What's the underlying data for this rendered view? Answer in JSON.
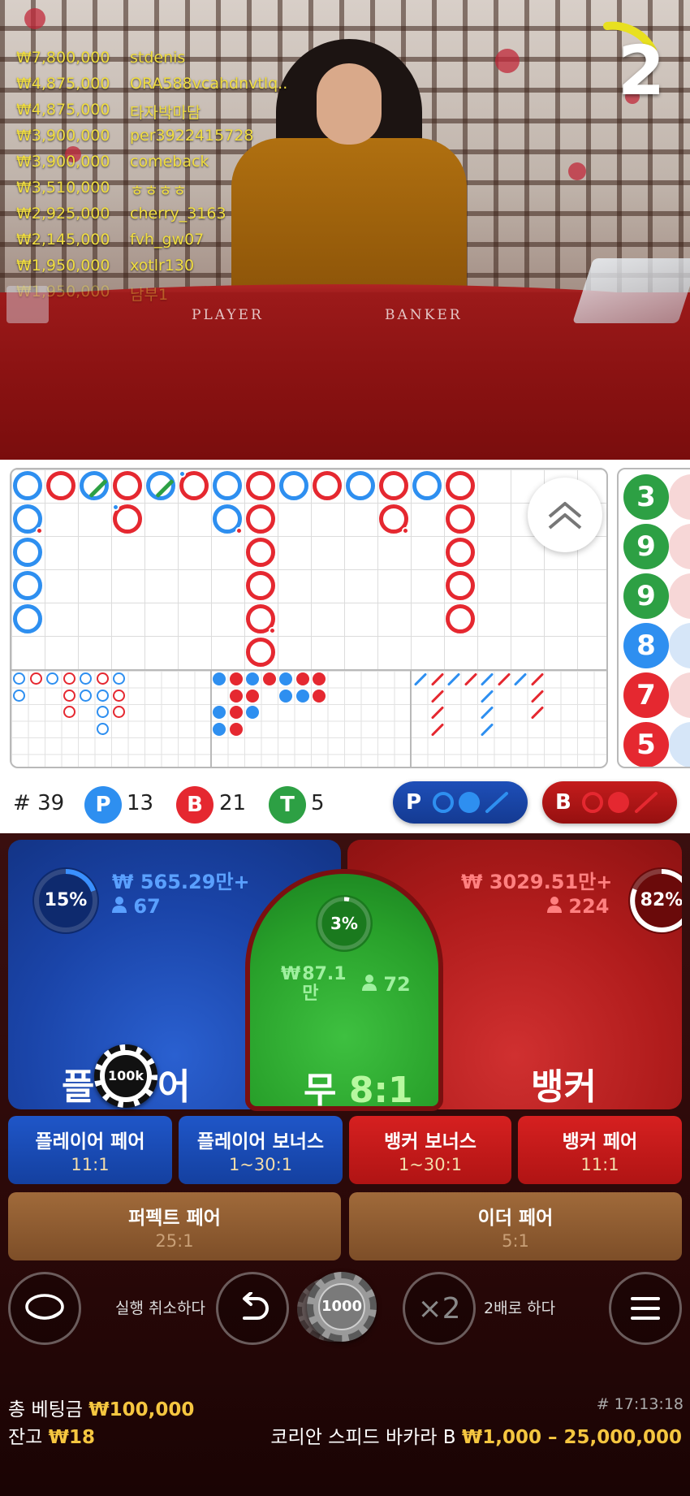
{
  "live_bets": [
    {
      "amount": "₩7,800,000",
      "user": "stdenis"
    },
    {
      "amount": "₩4,875,000",
      "user": "ORA588vcahdnvtlq.."
    },
    {
      "amount": "₩4,875,000",
      "user": "타자박마담"
    },
    {
      "amount": "₩3,900,000",
      "user": "per3922415728"
    },
    {
      "amount": "₩3,900,000",
      "user": "comeback"
    },
    {
      "amount": "₩3,510,000",
      "user": "ㅎㅎㅎㅎ"
    },
    {
      "amount": "₩2,925,000",
      "user": "cherry_3163"
    },
    {
      "amount": "₩2,145,000",
      "user": "fvh_gw07"
    },
    {
      "amount": "₩1,950,000",
      "user": "xotlr130"
    },
    {
      "amount": "₩1,950,000",
      "user": "남부1"
    }
  ],
  "table_labels": {
    "player": "PLAYER",
    "banker": "BANKER"
  },
  "timer": {
    "seconds": "2",
    "color": "#e8e020"
  },
  "colors": {
    "player": "#2e8ff0",
    "banker": "#e52830",
    "tie": "#2da044",
    "gold": "#f5c640"
  },
  "bead_road": [
    {
      "value": "3",
      "side": "t"
    },
    {
      "value": "9",
      "side": "t"
    },
    {
      "value": "9",
      "side": "t"
    },
    {
      "value": "8",
      "side": "p"
    },
    {
      "value": "7",
      "side": "b"
    },
    {
      "value": "5",
      "side": "b"
    }
  ],
  "stats": {
    "hash": "#",
    "rounds": "39",
    "player_letter": "P",
    "player_count": "13",
    "banker_letter": "B",
    "banker_count": "21",
    "tie_letter": "T",
    "tie_count": "5"
  },
  "predict": {
    "player_letter": "P",
    "banker_letter": "B"
  },
  "main_bets": {
    "player": {
      "label_left": "플",
      "label_right": "어",
      "percent": "15%",
      "pool": "₩ 565.29만+",
      "users": "67",
      "chip": "100k"
    },
    "tie": {
      "label": "무",
      "odds": "8:1",
      "percent": "3%",
      "pool": "₩87.1\n만",
      "pool_a": "₩",
      "pool_b": "87.1",
      "pool_c": "만",
      "users": "72"
    },
    "banker": {
      "label": "뱅커",
      "percent": "82%",
      "pool": "₩ 3029.51만+",
      "users": "224"
    }
  },
  "side_bets": [
    {
      "label": "플레이어 페어",
      "odds": "11:1"
    },
    {
      "label": "플레이어 보너스",
      "odds": "1~30:1"
    },
    {
      "label": "뱅커 보너스",
      "odds": "1~30:1"
    },
    {
      "label": "뱅커 페어",
      "odds": "11:1"
    }
  ],
  "extra_bets": [
    {
      "label": "퍼펙트 페어",
      "odds": "25:1"
    },
    {
      "label": "이더 페어",
      "odds": "5:1"
    }
  ],
  "controls": {
    "undo_label": "실행 취소하다",
    "chip_value": "1000",
    "double_symbol": "×2",
    "double_label": "2배로 하다"
  },
  "footer": {
    "total_bet_label": "총 베팅금",
    "total_bet_value": "₩100,000",
    "balance_label": "잔고",
    "balance_value": "₩18",
    "round_id": "# 17:13:18",
    "table_name": "코리안 스피드 바카라 B",
    "limits": "₩1,000 – 25,000,000"
  }
}
